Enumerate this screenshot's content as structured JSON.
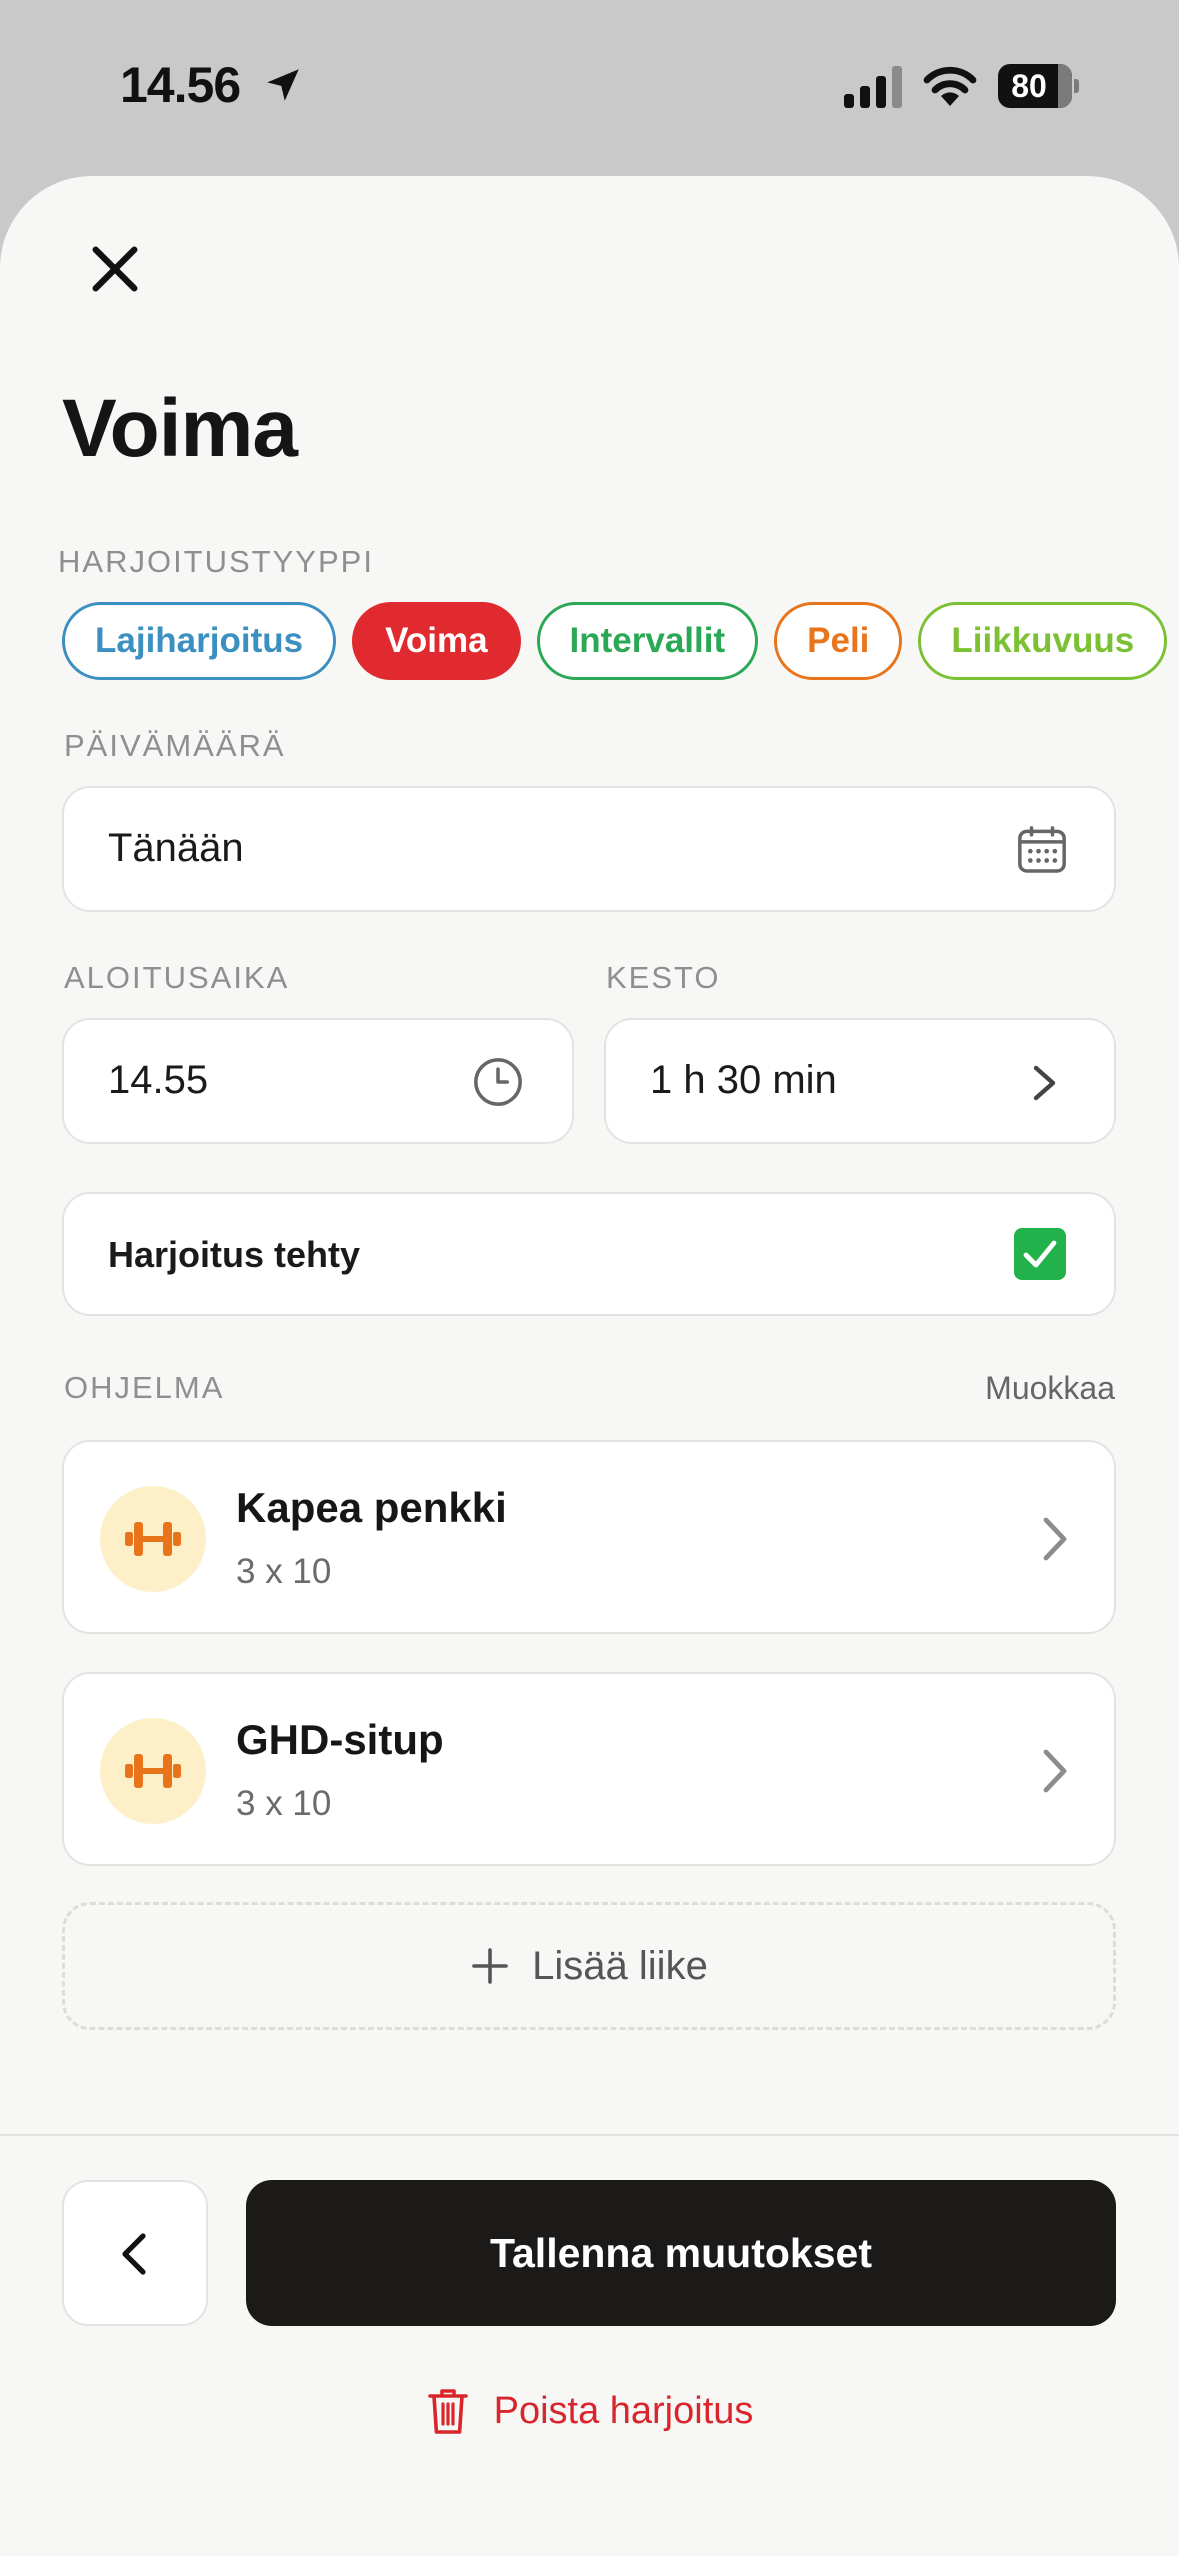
{
  "status_bar": {
    "time": "14.56",
    "battery": "80",
    "icons": [
      "location-arrow-icon",
      "cellular-signal-icon",
      "wifi-icon",
      "battery-icon"
    ]
  },
  "sheet": {
    "close_icon": "close-icon",
    "title": "Voima"
  },
  "workout_type": {
    "label": "HARJOITUSTYYPPI",
    "chips": [
      {
        "label": "Lajiharjoitus",
        "color": "#3b8fc1",
        "active": false
      },
      {
        "label": "Voima",
        "color": "#e02a2f",
        "active": true
      },
      {
        "label": "Intervallit",
        "color": "#2aa854",
        "active": false
      },
      {
        "label": "Peli",
        "color": "#e8741c",
        "active": false
      },
      {
        "label": "Liikkuvuus",
        "color": "#7cc134",
        "active": false
      }
    ]
  },
  "date": {
    "label": "PÄIVÄMÄÄRÄ",
    "value": "Tänään",
    "icon": "calendar-icon"
  },
  "start_time": {
    "label": "ALOITUSAIKA",
    "value": "14.55",
    "icon": "clock-icon"
  },
  "duration": {
    "label": "KESTO",
    "value": "1 h 30 min",
    "icon": "chevron-right-icon"
  },
  "done": {
    "label": "Harjoitus tehty",
    "checked": true,
    "color": "#22b24c"
  },
  "program": {
    "label": "OHJELMA",
    "edit_label": "Muokkaa",
    "exercises": [
      {
        "name": "Kapea penkki",
        "sets": "3 x 10",
        "icon": "dumbbell-icon"
      },
      {
        "name": "GHD-situp",
        "sets": "3 x 10",
        "icon": "dumbbell-icon"
      }
    ],
    "add_label": "Lisää liike",
    "add_icon": "plus-icon"
  },
  "footer": {
    "back_icon": "chevron-left-icon",
    "save_label": "Tallenna muutokset",
    "delete_label": "Poista harjoitus",
    "delete_icon": "trash-icon",
    "delete_color": "#d8262c"
  }
}
